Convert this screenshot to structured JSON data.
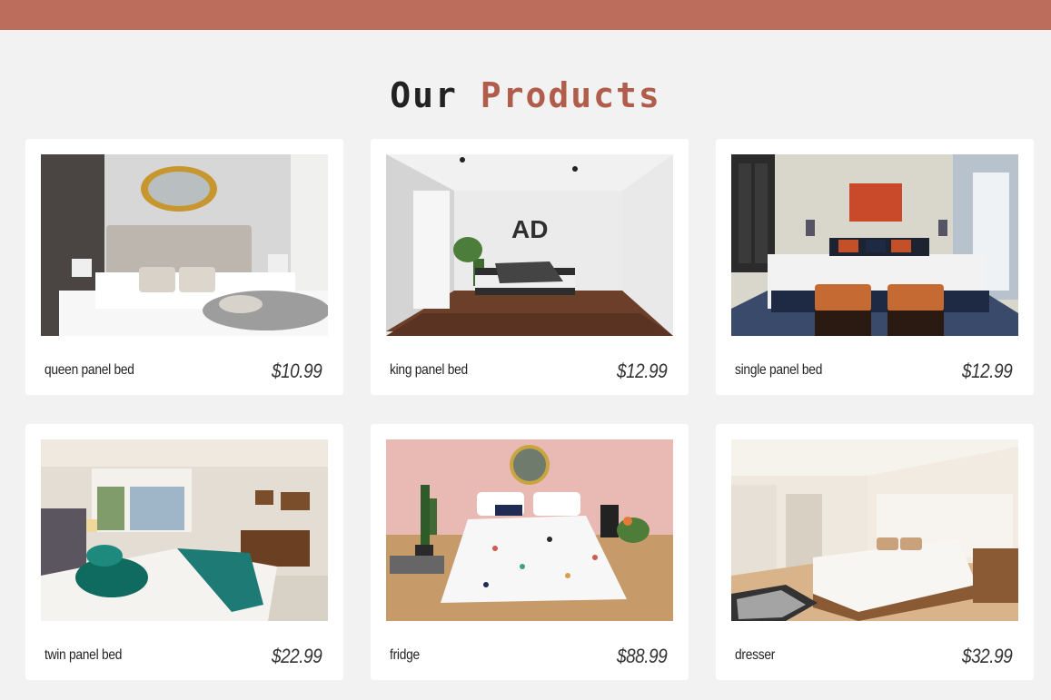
{
  "header": {
    "title_part1": "Our",
    "title_part2": "Products"
  },
  "colors": {
    "topbar": "#bd6d5b",
    "accent": "#b05d4c",
    "background": "#f2f2f2"
  },
  "products": [
    {
      "name": "queen panel bed",
      "price": "$10.99",
      "image": "bedroom-photo"
    },
    {
      "name": "king panel bed",
      "price": "$12.99",
      "image": "bedroom-photo"
    },
    {
      "name": "single panel bed",
      "price": "$12.99",
      "image": "bedroom-photo"
    },
    {
      "name": "twin panel bed",
      "price": "$22.99",
      "image": "bedroom-photo"
    },
    {
      "name": "fridge",
      "price": "$88.99",
      "image": "bedroom-photo"
    },
    {
      "name": "dresser",
      "price": "$32.99",
      "image": "bedroom-photo"
    }
  ]
}
